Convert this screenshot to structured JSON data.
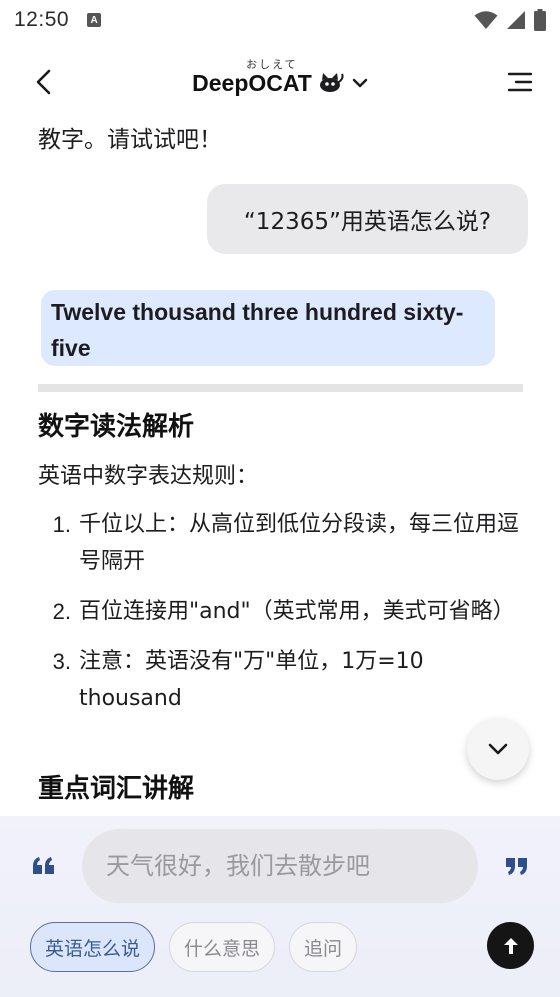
{
  "status_bar": {
    "time": "12:50",
    "notification_badge": "A",
    "icons": [
      "wifi-icon",
      "signal-icon",
      "battery-icon"
    ]
  },
  "header": {
    "title_ruby": "おしえて",
    "title": "DeepOCAT",
    "icons": [
      "back-arrow-icon",
      "cat-logo-icon",
      "chevron-down-icon",
      "menu-icon"
    ]
  },
  "chat": {
    "prev_text": "教字。请试试吧！",
    "user_message": "“12365”用英语怎么说?",
    "answer": "Twelve thousand three hundred sixty-five",
    "section1_title": "数字读法解析",
    "intro": "英语中数字表达规则：",
    "rules": [
      {
        "num": "1.",
        "text": "千位以上：从高位到低位分段读，每三位用逗号隔开"
      },
      {
        "num": "2.",
        "text": "百位连接用\"and\"（英式常用，美式可省略）"
      },
      {
        "num": "3.",
        "text": "注意：英语没有\"万\"单位，1万=10 thousand"
      }
    ],
    "section2_title": "重点词汇讲解"
  },
  "input": {
    "placeholder": "天气很好，我们去散步吧",
    "value": ""
  },
  "chips": [
    {
      "label": "英语怎么说",
      "active": true
    },
    {
      "label": "什么意思",
      "active": false
    },
    {
      "label": "追问",
      "active": false
    }
  ],
  "colors": {
    "answer_bubble": "#dde9ff",
    "user_bubble": "#e9e9eb",
    "accent_quote": "#2d4f8e",
    "send_button": "#151515"
  }
}
